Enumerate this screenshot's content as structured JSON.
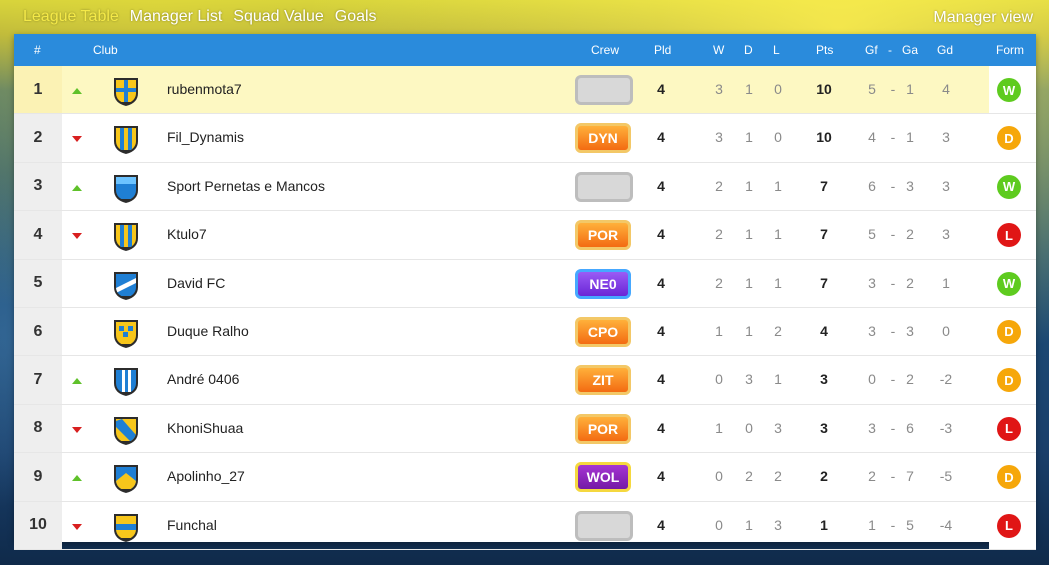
{
  "nav": {
    "tabs": [
      "League Table",
      "Manager List",
      "Squad Value",
      "Goals"
    ],
    "right": "Manager view"
  },
  "header": {
    "pos": "#",
    "club": "Club",
    "crew": "Crew",
    "pld": "Pld",
    "w": "W",
    "d": "D",
    "l": "L",
    "pts": "Pts",
    "gf": "Gf",
    "dash": "-",
    "ga": "Ga",
    "gd": "Gd",
    "form": "Form"
  },
  "rows": [
    {
      "pos": "1",
      "trend": "up",
      "club": "rubenmota7",
      "crew": "",
      "crew_style": "empty",
      "pld": "4",
      "w": "3",
      "d": "1",
      "l": "0",
      "pts": "10",
      "gf": "5",
      "ga": "1",
      "gd": "4",
      "form": "W",
      "crest": "yellow-blue-cross"
    },
    {
      "pos": "2",
      "trend": "down",
      "club": "Fil_Dynamis",
      "crew": "DYN",
      "crew_style": "orange",
      "pld": "4",
      "w": "3",
      "d": "1",
      "l": "0",
      "pts": "10",
      "gf": "4",
      "ga": "1",
      "gd": "3",
      "form": "D",
      "crest": "yellow-blue-stripes"
    },
    {
      "pos": "3",
      "trend": "up",
      "club": "Sport Pernetas e Mancos",
      "crew": "",
      "crew_style": "empty",
      "pld": "4",
      "w": "2",
      "d": "1",
      "l": "1",
      "pts": "7",
      "gf": "6",
      "ga": "3",
      "gd": "3",
      "form": "W",
      "crest": "blue-yoke"
    },
    {
      "pos": "4",
      "trend": "down",
      "club": "Ktulo7",
      "crew": "POR",
      "crew_style": "orange",
      "pld": "4",
      "w": "2",
      "d": "1",
      "l": "1",
      "pts": "7",
      "gf": "5",
      "ga": "2",
      "gd": "3",
      "form": "L",
      "crest": "yellow-blue-stripes"
    },
    {
      "pos": "5",
      "trend": "none",
      "club": "David FC",
      "crew": "NE0",
      "crew_style": "purple",
      "pld": "4",
      "w": "2",
      "d": "1",
      "l": "1",
      "pts": "7",
      "gf": "3",
      "ga": "2",
      "gd": "1",
      "form": "W",
      "crest": "blue-white-sash"
    },
    {
      "pos": "6",
      "trend": "none",
      "club": "Duque Ralho",
      "crew": "CPO",
      "crew_style": "orange",
      "pld": "4",
      "w": "1",
      "d": "1",
      "l": "2",
      "pts": "4",
      "gf": "3",
      "ga": "3",
      "gd": "0",
      "form": "D",
      "crest": "yellow-checks"
    },
    {
      "pos": "7",
      "trend": "up",
      "club": "André 0406",
      "crew": "ZIT",
      "crew_style": "orange",
      "pld": "4",
      "w": "0",
      "d": "3",
      "l": "1",
      "pts": "3",
      "gf": "0",
      "ga": "2",
      "gd": "-2",
      "form": "D",
      "crest": "blue-white-stripes"
    },
    {
      "pos": "8",
      "trend": "down",
      "club": "KhoniShuaa",
      "crew": "POR",
      "crew_style": "orange",
      "pld": "4",
      "w": "1",
      "d": "0",
      "l": "3",
      "pts": "3",
      "gf": "3",
      "ga": "6",
      "gd": "-3",
      "form": "L",
      "crest": "yellow-blue-sash"
    },
    {
      "pos": "9",
      "trend": "up",
      "club": "Apolinho_27",
      "crew": "WOL",
      "crew_style": "violet",
      "pld": "4",
      "w": "0",
      "d": "2",
      "l": "2",
      "pts": "2",
      "gf": "2",
      "ga": "7",
      "gd": "-5",
      "form": "D",
      "crest": "blue-yellow-chevron"
    },
    {
      "pos": "10",
      "trend": "down",
      "club": "Funchal",
      "crew": "",
      "crew_style": "empty",
      "pld": "4",
      "w": "0",
      "d": "1",
      "l": "3",
      "pts": "1",
      "gf": "1",
      "ga": "5",
      "gd": "-4",
      "form": "L",
      "crest": "yellow-blue-hoop"
    }
  ],
  "colors": {
    "header_blue": "#2a8bdc",
    "active_tab": "#f4e948",
    "highlight_row": "#fdf8c2",
    "win": "#5ecb1f",
    "draw": "#f6a70a",
    "loss": "#e01616"
  }
}
